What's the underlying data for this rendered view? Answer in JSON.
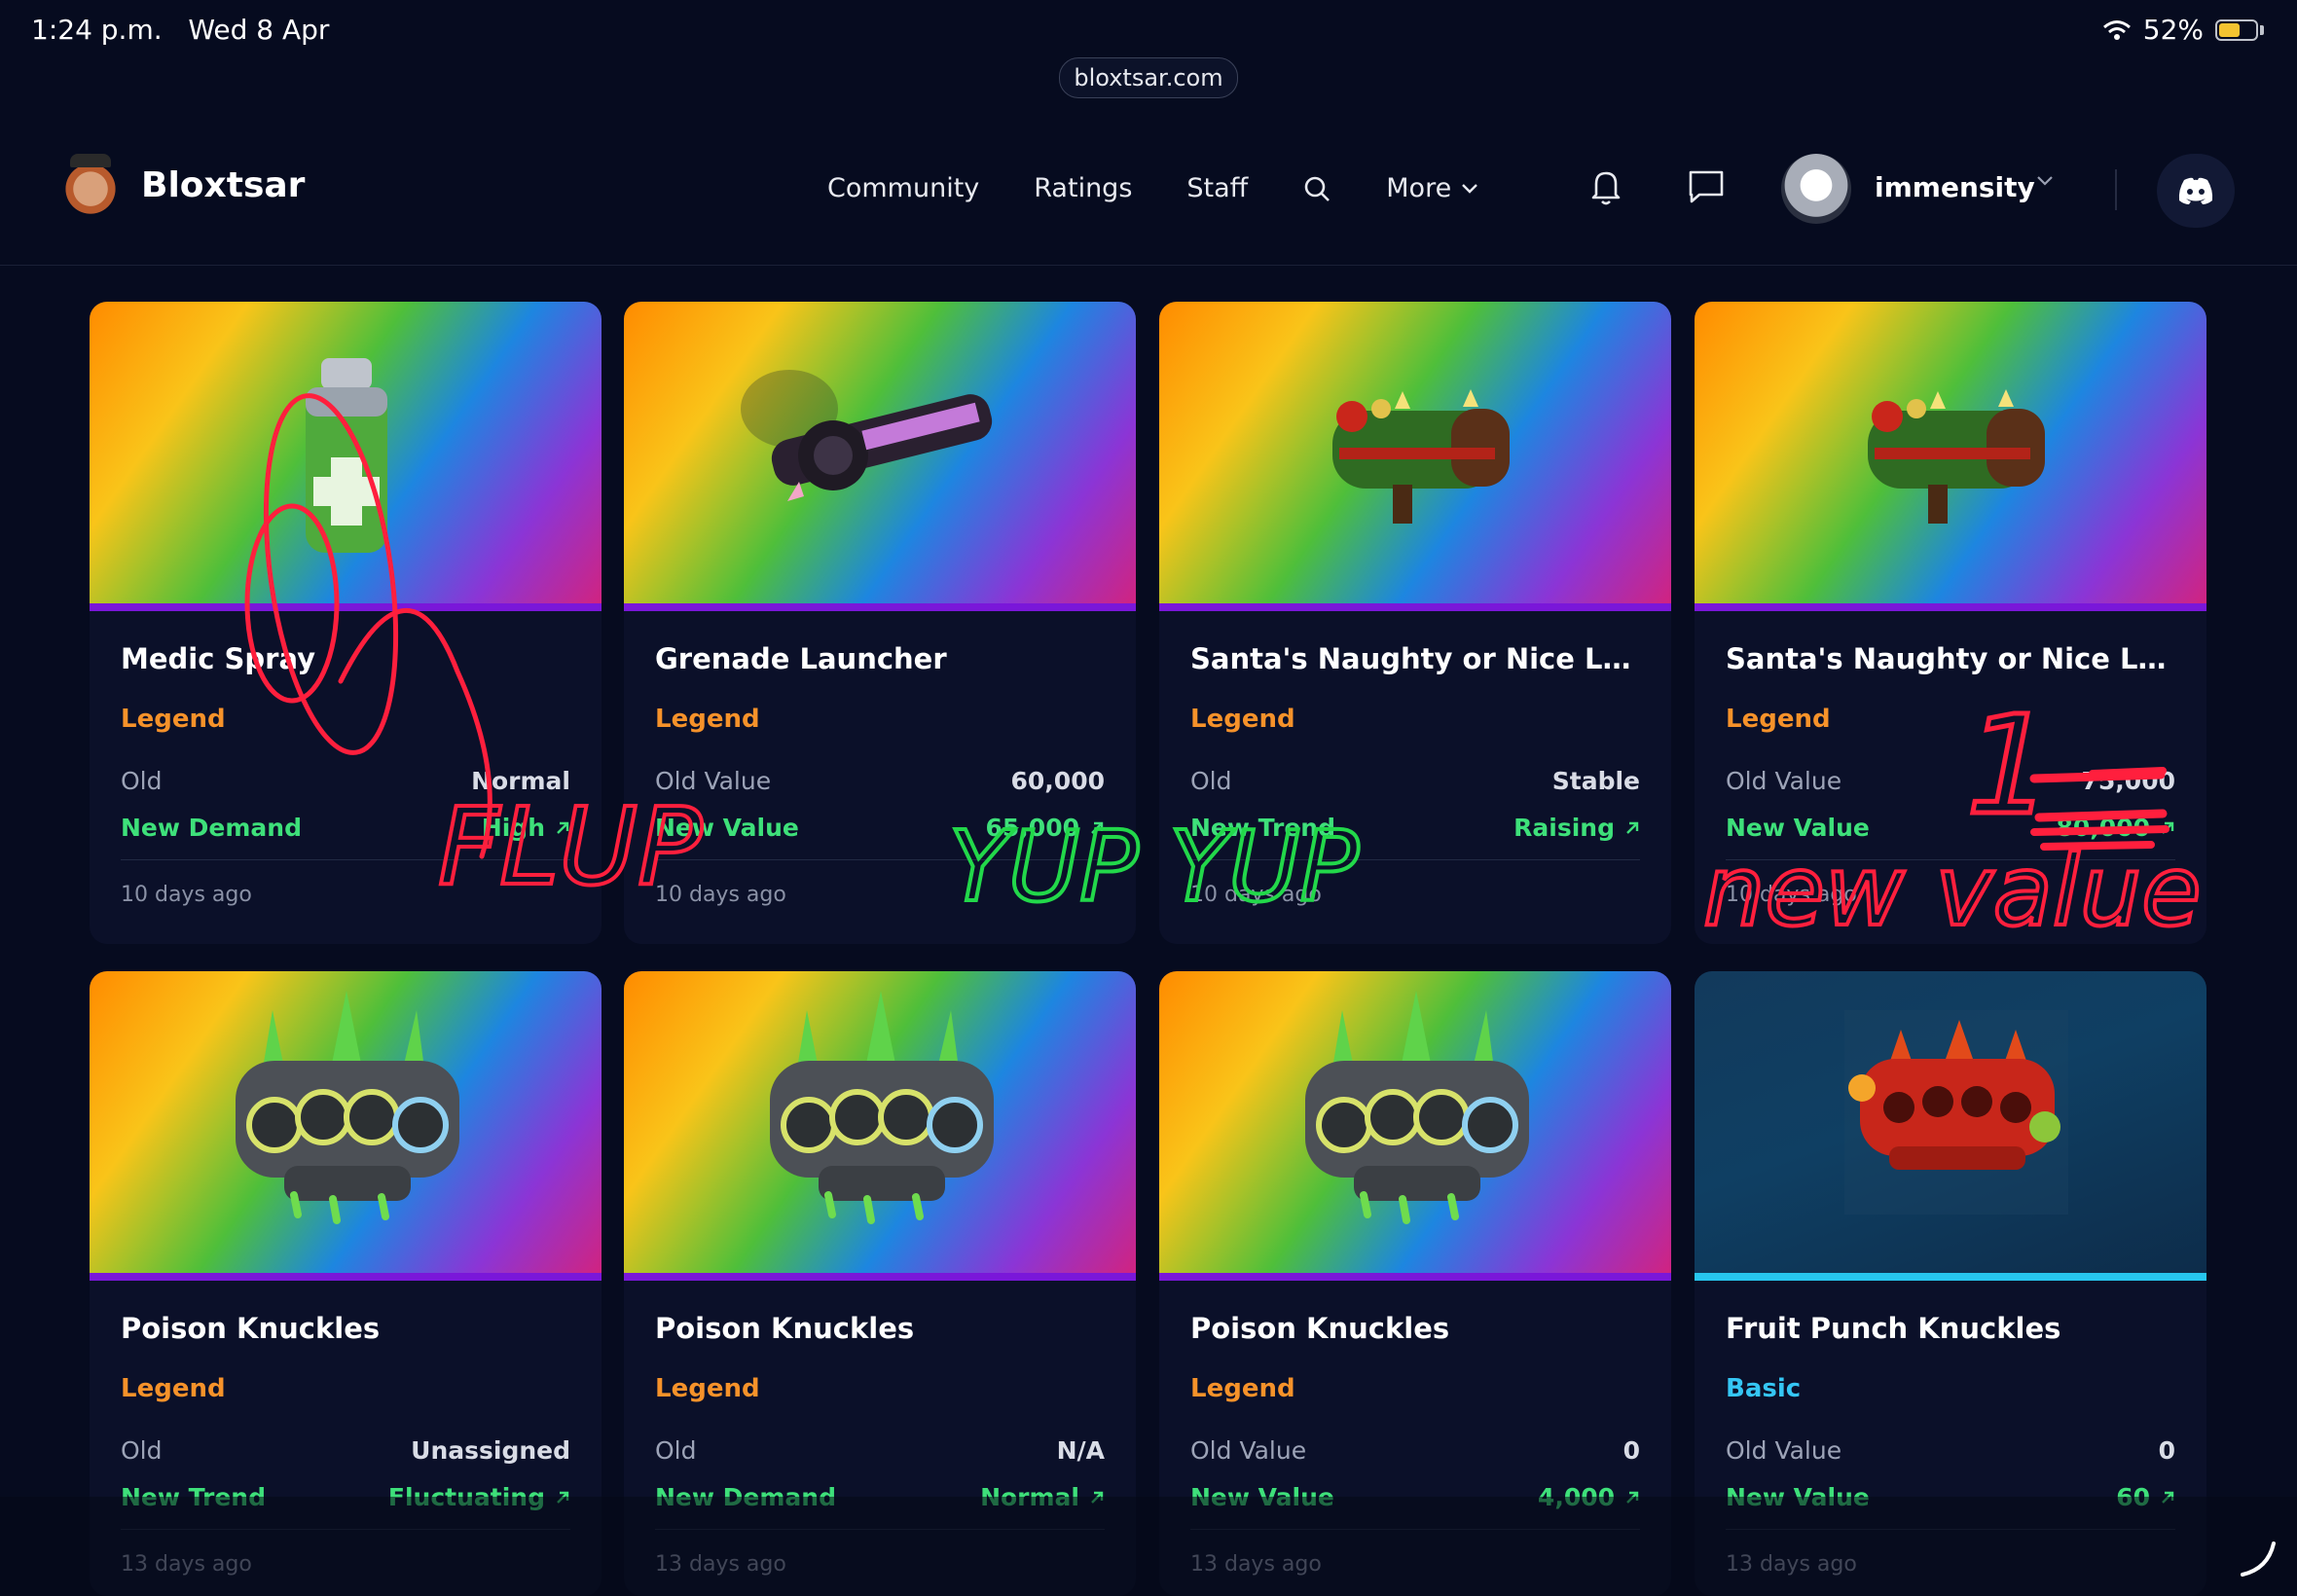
{
  "status_bar": {
    "time": "1:24 p.m.",
    "date": "Wed 8 Apr",
    "battery": "52%",
    "battery_level": 0.52,
    "wifi_icon": "wifi-icon"
  },
  "browser": {
    "url": "bloxtsar.com"
  },
  "header": {
    "brand": "Bloxtsar",
    "nav": [
      "Community",
      "Ratings",
      "Staff"
    ],
    "more_label": "More",
    "username": "immensity"
  },
  "cards": [
    {
      "title": "Medic Spray",
      "rarity": "Legend",
      "old_label": "Old",
      "old_value": "Normal",
      "new_label": "New Demand",
      "new_value": "High",
      "time": "10 days ago",
      "item": "medic-spray"
    },
    {
      "title": "Grenade Launcher",
      "rarity": "Legend",
      "old_label": "Old Value",
      "old_value": "60,000",
      "new_label": "New Value",
      "new_value": "65,000",
      "time": "10 days ago",
      "item": "grenade-launcher"
    },
    {
      "title": "Santa's Naughty or Nice Launc...",
      "rarity": "Legend",
      "old_label": "Old",
      "old_value": "Stable",
      "new_label": "New Trend",
      "new_value": "Raising",
      "time": "10 days ago",
      "item": "santa-launcher"
    },
    {
      "title": "Santa's Naughty or Nice Launc...",
      "rarity": "Legend",
      "old_label": "Old Value",
      "old_value": "75,000",
      "new_label": "New Value",
      "new_value": "80,000",
      "time": "10 days ago",
      "item": "santa-launcher"
    },
    {
      "title": "Poison Knuckles",
      "rarity": "Legend",
      "old_label": "Old",
      "old_value": "Unassigned",
      "new_label": "New Trend",
      "new_value": "Fluctuating",
      "time": "13 days ago",
      "item": "poison-knuckles"
    },
    {
      "title": "Poison Knuckles",
      "rarity": "Legend",
      "old_label": "Old",
      "old_value": "N/A",
      "new_label": "New Demand",
      "new_value": "Normal",
      "time": "13 days ago",
      "item": "poison-knuckles"
    },
    {
      "title": "Poison Knuckles",
      "rarity": "Legend",
      "old_label": "Old Value",
      "old_value": "0",
      "new_label": "New Value",
      "new_value": "4,000",
      "time": "13 days ago",
      "item": "poison-knuckles"
    },
    {
      "title": "Fruit Punch Knuckles",
      "rarity": "Basic",
      "old_label": "Old Value",
      "old_value": "0",
      "new_label": "New Value",
      "new_value": "60",
      "time": "13 days ago",
      "item": "fruit-punch-knuckles"
    }
  ],
  "colors": {
    "legend": "#f6922a",
    "basic": "#35c6f4",
    "positive": "#3ee07a",
    "background": "#060b1f"
  },
  "annotations": {
    "red_left_text": "FLUP",
    "green_text": "YUP YUP",
    "red_right_number": "1",
    "red_right_text": "new value"
  }
}
